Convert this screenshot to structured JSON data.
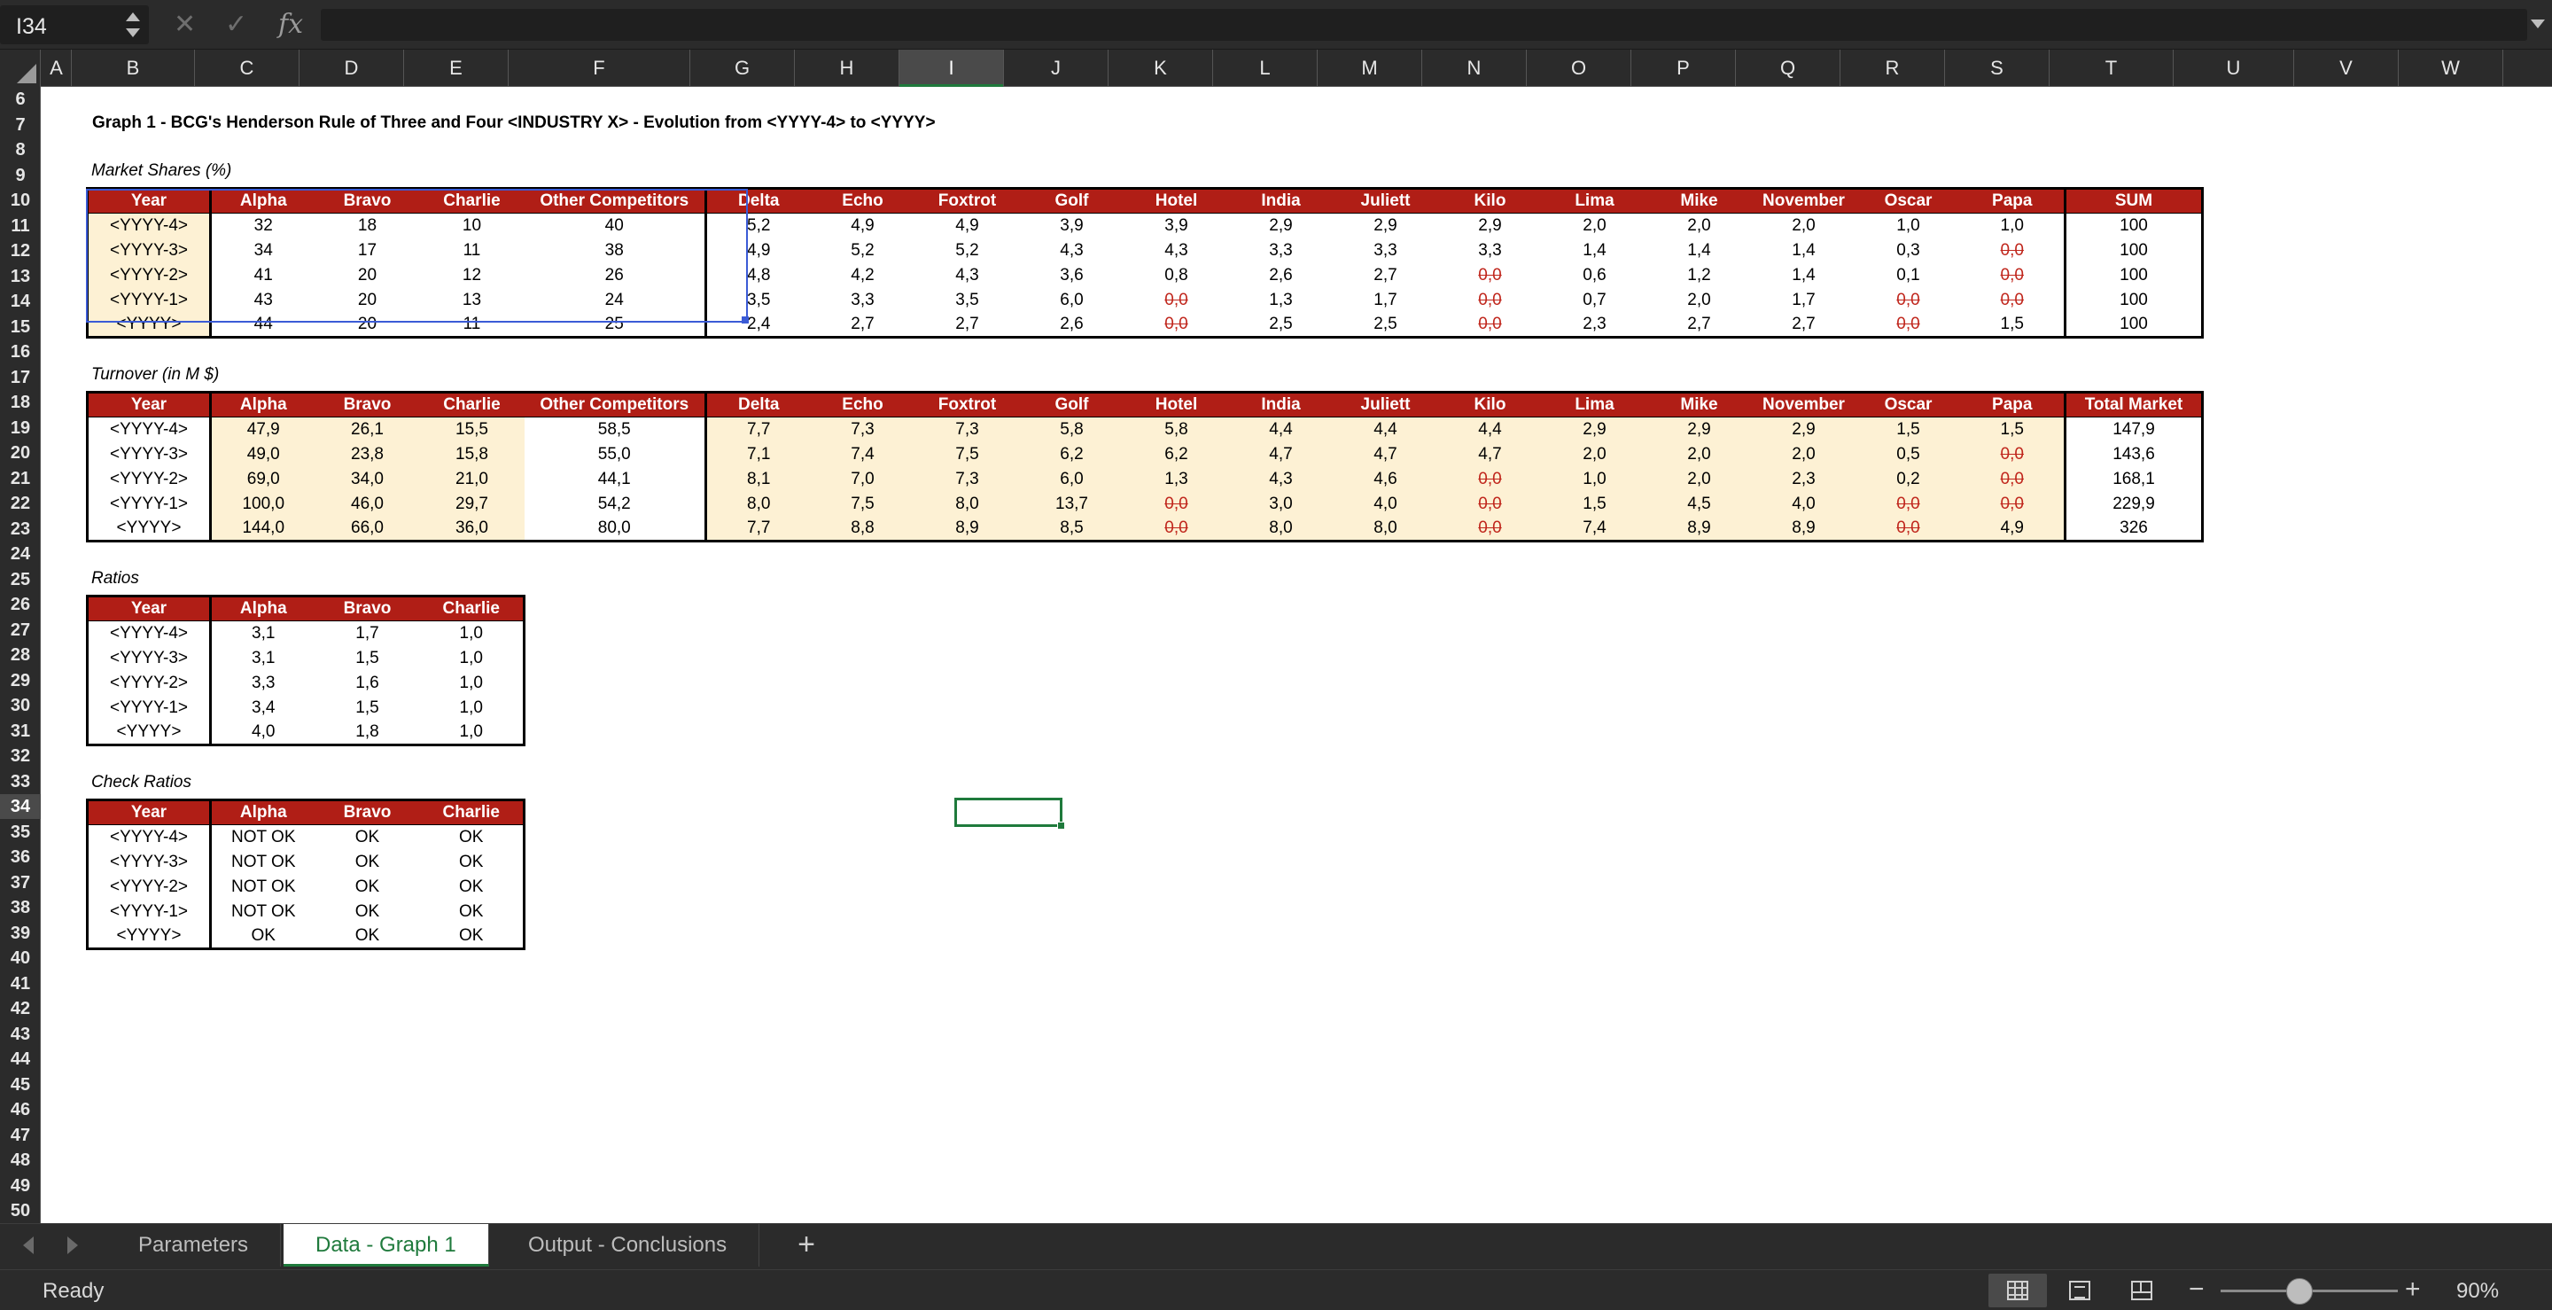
{
  "formula_bar": {
    "name_box": "I34",
    "cancel_icon": "close-icon",
    "enter_icon": "check-icon",
    "fx_label": "fx",
    "formula": ""
  },
  "columns": [
    "A",
    "B",
    "C",
    "D",
    "E",
    "F",
    "G",
    "H",
    "I",
    "J",
    "K",
    "L",
    "M",
    "N",
    "O",
    "P",
    "Q",
    "R",
    "S",
    "T",
    "U",
    "V",
    "W"
  ],
  "selected_column": "I",
  "rows": [
    6,
    7,
    8,
    9,
    10,
    11,
    12,
    13,
    14,
    15,
    16,
    17,
    18,
    19,
    20,
    21,
    22,
    23,
    24,
    25,
    26,
    27,
    28,
    29,
    30,
    31,
    32,
    33,
    34,
    35,
    36,
    37,
    38,
    39,
    40,
    41,
    42,
    43,
    44,
    45,
    46,
    47,
    48,
    49,
    50
  ],
  "selected_row": 34,
  "sheet": {
    "title": "Graph 1 - BCG's Henderson Rule of Three and Four <INDUSTRY X> - Evolution from <YYYY-4> to <YYYY>",
    "market_shares": {
      "label": "Market Shares (%)",
      "headers": [
        "Year",
        "Alpha",
        "Bravo",
        "Charlie",
        "Other Competitors",
        "Delta",
        "Echo",
        "Foxtrot",
        "Golf",
        "Hotel",
        "India",
        "Juliett",
        "Kilo",
        "Lima",
        "Mike",
        "November",
        "Oscar",
        "Papa",
        "SUM"
      ],
      "rows": [
        [
          "<YYYY-4>",
          "32",
          "18",
          "10",
          "40",
          "5,2",
          "4,9",
          "4,9",
          "3,9",
          "3,9",
          "2,9",
          "2,9",
          "2,9",
          "2,0",
          "2,0",
          "2,0",
          "1,0",
          "1,0",
          "100"
        ],
        [
          "<YYYY-3>",
          "34",
          "17",
          "11",
          "38",
          "4,9",
          "5,2",
          "5,2",
          "4,3",
          "4,3",
          "3,3",
          "3,3",
          "3,3",
          "1,4",
          "1,4",
          "1,4",
          "0,3",
          "0,0",
          "100"
        ],
        [
          "<YYYY-2>",
          "41",
          "20",
          "12",
          "26",
          "4,8",
          "4,2",
          "4,3",
          "3,6",
          "0,8",
          "2,6",
          "2,7",
          "0,0",
          "0,6",
          "1,2",
          "1,4",
          "0,1",
          "0,0",
          "100"
        ],
        [
          "<YYYY-1>",
          "43",
          "20",
          "13",
          "24",
          "3,5",
          "3,3",
          "3,5",
          "6,0",
          "0,0",
          "1,3",
          "1,7",
          "0,0",
          "0,7",
          "2,0",
          "1,7",
          "0,0",
          "0,0",
          "100"
        ],
        [
          "<YYYY>",
          "44",
          "20",
          "11",
          "25",
          "2,4",
          "2,7",
          "2,7",
          "2,6",
          "0,0",
          "2,5",
          "2,5",
          "0,0",
          "2,3",
          "2,7",
          "2,7",
          "0,0",
          "1,5",
          "100"
        ]
      ]
    },
    "turnover": {
      "label": "Turnover (in M $)",
      "headers": [
        "Year",
        "Alpha",
        "Bravo",
        "Charlie",
        "Other Competitors",
        "Delta",
        "Echo",
        "Foxtrot",
        "Golf",
        "Hotel",
        "India",
        "Juliett",
        "Kilo",
        "Lima",
        "Mike",
        "November",
        "Oscar",
        "Papa",
        "Total Market"
      ],
      "rows": [
        [
          "<YYYY-4>",
          "47,9",
          "26,1",
          "15,5",
          "58,5",
          "7,7",
          "7,3",
          "7,3",
          "5,8",
          "5,8",
          "4,4",
          "4,4",
          "4,4",
          "2,9",
          "2,9",
          "2,9",
          "1,5",
          "1,5",
          "147,9"
        ],
        [
          "<YYYY-3>",
          "49,0",
          "23,8",
          "15,8",
          "55,0",
          "7,1",
          "7,4",
          "7,5",
          "6,2",
          "6,2",
          "4,7",
          "4,7",
          "4,7",
          "2,0",
          "2,0",
          "2,0",
          "0,5",
          "0,0",
          "143,6"
        ],
        [
          "<YYYY-2>",
          "69,0",
          "34,0",
          "21,0",
          "44,1",
          "8,1",
          "7,0",
          "7,3",
          "6,0",
          "1,3",
          "4,3",
          "4,6",
          "0,0",
          "1,0",
          "2,0",
          "2,3",
          "0,2",
          "0,0",
          "168,1"
        ],
        [
          "<YYYY-1>",
          "100,0",
          "46,0",
          "29,7",
          "54,2",
          "8,0",
          "7,5",
          "8,0",
          "13,7",
          "0,0",
          "3,0",
          "4,0",
          "0,0",
          "1,5",
          "4,5",
          "4,0",
          "0,0",
          "0,0",
          "229,9"
        ],
        [
          "<YYYY>",
          "144,0",
          "66,0",
          "36,0",
          "80,0",
          "7,7",
          "8,8",
          "8,9",
          "8,5",
          "0,0",
          "8,0",
          "8,0",
          "0,0",
          "7,4",
          "8,9",
          "8,9",
          "0,0",
          "4,9",
          "326"
        ]
      ]
    },
    "ratios": {
      "label": "Ratios",
      "headers": [
        "Year",
        "Alpha",
        "Bravo",
        "Charlie"
      ],
      "rows": [
        [
          "<YYYY-4>",
          "3,1",
          "1,7",
          "1,0"
        ],
        [
          "<YYYY-3>",
          "3,1",
          "1,5",
          "1,0"
        ],
        [
          "<YYYY-2>",
          "3,3",
          "1,6",
          "1,0"
        ],
        [
          "<YYYY-1>",
          "3,4",
          "1,5",
          "1,0"
        ],
        [
          "<YYYY>",
          "4,0",
          "1,8",
          "1,0"
        ]
      ]
    },
    "check_ratios": {
      "label": "Check Ratios",
      "headers": [
        "Year",
        "Alpha",
        "Bravo",
        "Charlie"
      ],
      "rows": [
        [
          "<YYYY-4>",
          "NOT OK",
          "OK",
          "OK"
        ],
        [
          "<YYYY-3>",
          "NOT OK",
          "OK",
          "OK"
        ],
        [
          "<YYYY-2>",
          "NOT OK",
          "OK",
          "OK"
        ],
        [
          "<YYYY-1>",
          "NOT OK",
          "OK",
          "OK"
        ],
        [
          "<YYYY>",
          "OK",
          "OK",
          "OK"
        ]
      ]
    }
  },
  "tabs": [
    "Parameters",
    "Data - Graph 1",
    "Output - Conclusions"
  ],
  "active_tab": "Data - Graph 1",
  "add_tab_label": "+",
  "status": {
    "text": "Ready",
    "zoom": "90%",
    "zoom_level_percent": 90
  },
  "colors": {
    "header_red": "#b01e16",
    "beige": "#fdf1d4",
    "active_green": "#1f7a3c",
    "zero_red": "#c0261c"
  }
}
